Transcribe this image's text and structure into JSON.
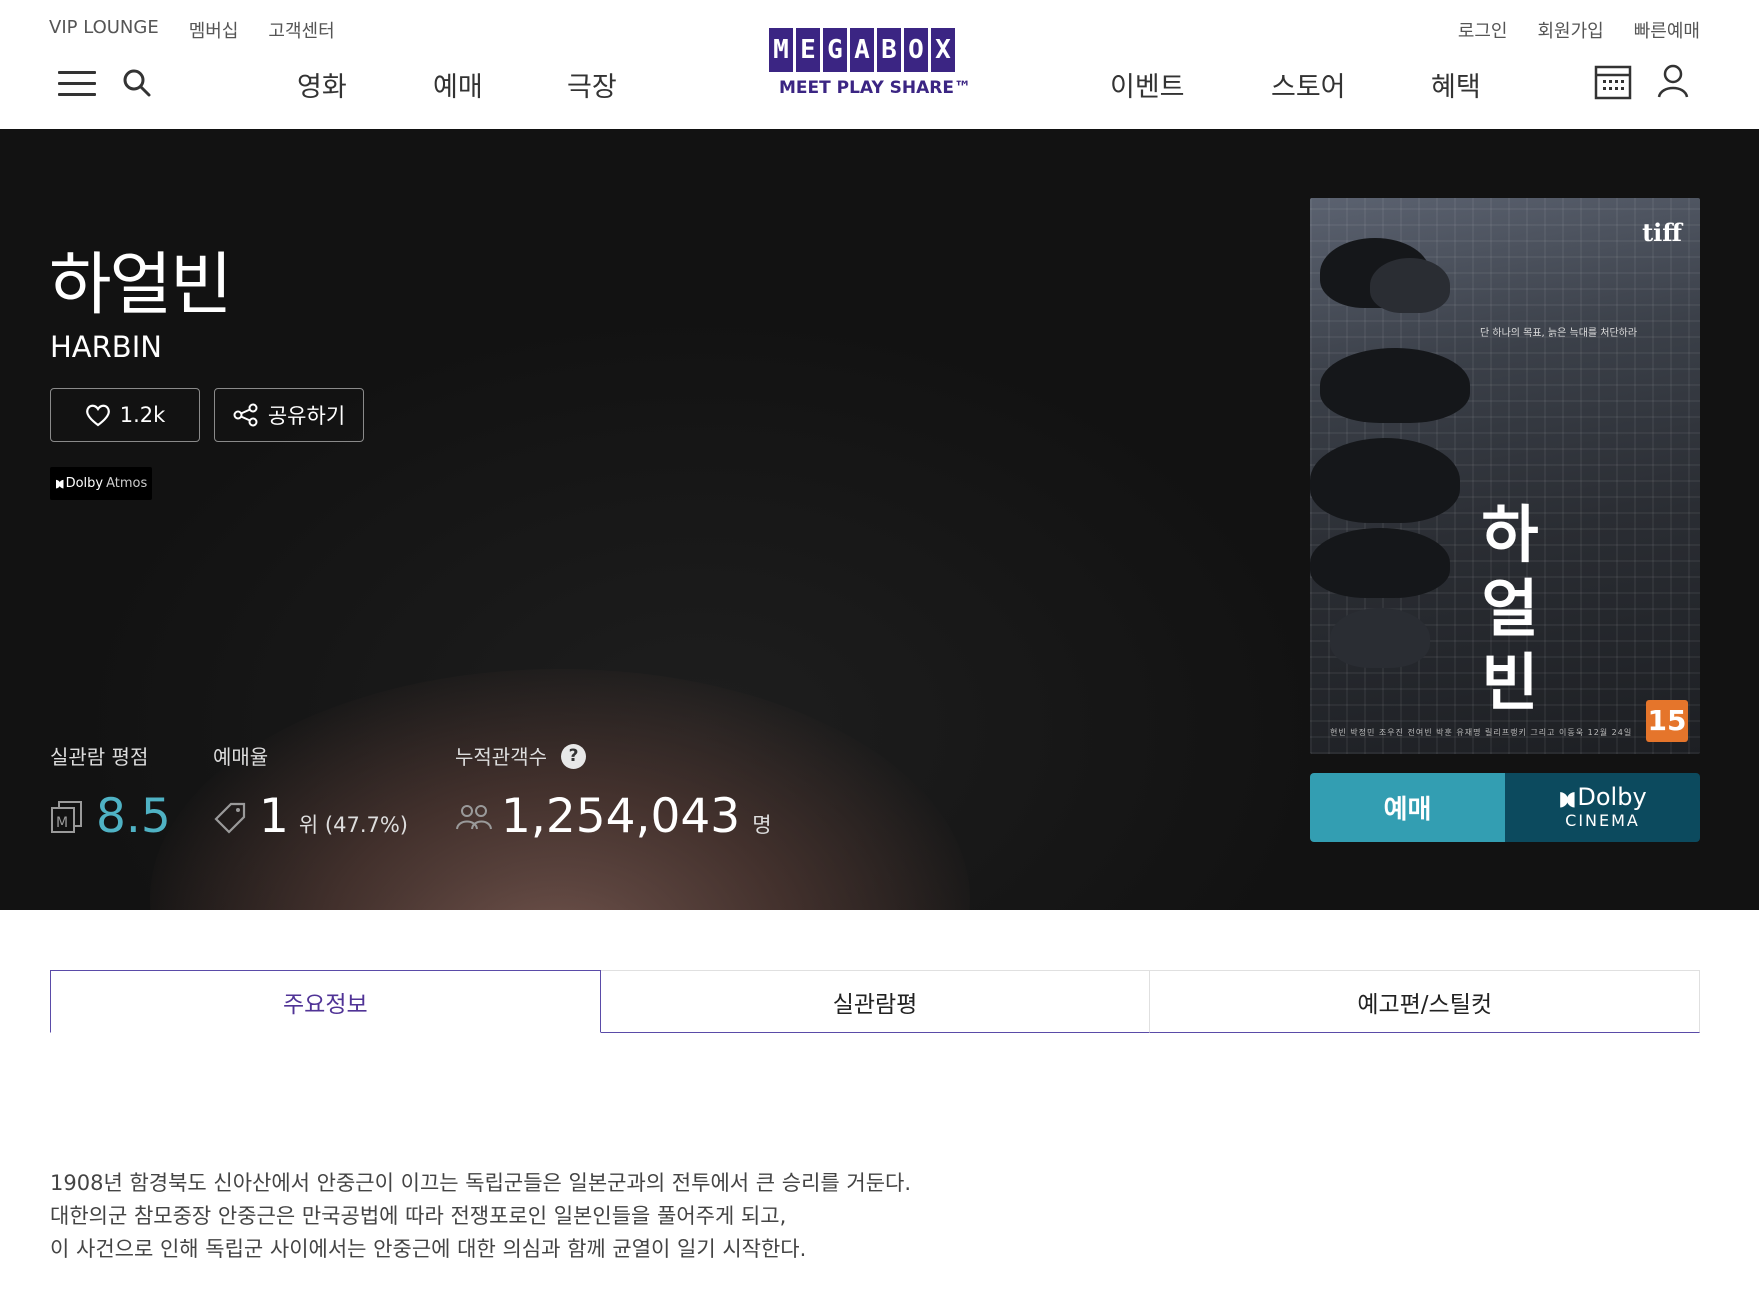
{
  "header": {
    "util_left": [
      "VIP LOUNGE",
      "멤버십",
      "고객센터"
    ],
    "util_right": [
      "로그인",
      "회원가입",
      "빠른예매"
    ],
    "nav_left": [
      "영화",
      "예매",
      "극장"
    ],
    "nav_right": [
      "이벤트",
      "스토어",
      "혜택"
    ],
    "logo": {
      "word": "MEGABOX",
      "sub": "MEET PLAY SHARE™"
    }
  },
  "movie": {
    "title_ko": "하얼빈",
    "title_en": "HARBIN",
    "likes": "1.2k",
    "share_label": "공유하기",
    "badge": {
      "brand": "Dolby",
      "format": "Atmos"
    },
    "stats": {
      "rating_label": "실관람 평점",
      "rating": "8.5",
      "booking_label": "예매율",
      "rank": "1",
      "rank_sub": "위 (47.7%)",
      "audience_label": "누적관객수",
      "audience": "1,254,043",
      "audience_unit": "명"
    },
    "poster": {
      "festival": "tiff",
      "tagline": "단 하나의 목표, 늙은 늑대를 처단하라",
      "title_chars": [
        "하",
        "얼",
        "빈"
      ],
      "age_rating": "15",
      "credits": "현빈 박정민 조우진 전여빈 박훈 유재명 릴리프랭키 그리고 이동욱   12월 24일"
    },
    "book_label": "예매",
    "dolby_cinema": {
      "brand": "Dolby",
      "label": "CINEMA"
    }
  },
  "tabs": [
    {
      "label": "주요정보",
      "active": true
    },
    {
      "label": "실관람평",
      "active": false
    },
    {
      "label": "예고편/스틸컷",
      "active": false
    }
  ],
  "synopsis": [
    "1908년 함경북도 신아산에서 안중근이 이끄는 독립군들은 일본군과의 전투에서 큰 승리를 거둔다.",
    "대한의군 참모중장 안중근은 만국공법에 따라 전쟁포로인 일본인들을 풀어주게 되고,",
    "이 사건으로 인해 독립군 사이에서는 안중근에 대한 의심과 함께 균열이 일기 시작한다."
  ],
  "colors": {
    "brand": "#3b2583",
    "accent": "#339eb2",
    "rating": "#4fb2c4",
    "dolby": "#0c4a5e",
    "age": "#e5752b"
  }
}
